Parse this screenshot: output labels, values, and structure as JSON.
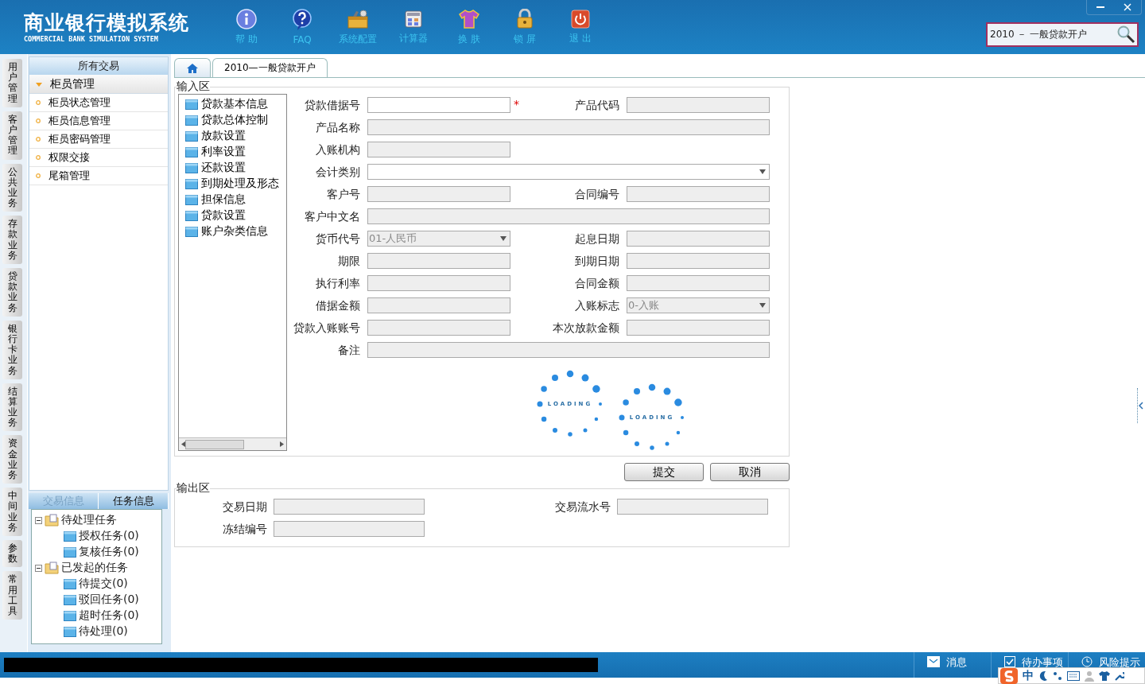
{
  "header": {
    "title": "商业银行模拟系统",
    "subtitle": "COMMERCIAL BANK SIMULATION SYSTEM",
    "tools": [
      {
        "label": "帮 助",
        "kind": "info"
      },
      {
        "label": "FAQ",
        "kind": "question"
      },
      {
        "label": "系统配置",
        "kind": "toolbox"
      },
      {
        "label": "计算器",
        "kind": "calculator"
      },
      {
        "label": "换 肤",
        "kind": "shirt"
      },
      {
        "label": "锁 屏",
        "kind": "lock"
      },
      {
        "label": "退 出",
        "kind": "power"
      }
    ],
    "search": {
      "value": "2010 － 一般贷款开户"
    }
  },
  "side_tabs": [
    {
      "label": "用户管理"
    },
    {
      "label": "客户管理"
    },
    {
      "label": "公共业务"
    },
    {
      "label": "存款业务"
    },
    {
      "label": "贷款业务"
    },
    {
      "label": "银行卡业务"
    },
    {
      "label": "结算业务"
    },
    {
      "label": "资金业务"
    },
    {
      "label": "中间业务"
    },
    {
      "label": "参数"
    },
    {
      "label": "常用工具"
    }
  ],
  "menu": {
    "title": "所有交易",
    "group": {
      "label": "柜员管理",
      "expanded": true,
      "items": [
        "柜员状态管理",
        "柜员信息管理",
        "柜员密码管理",
        "权限交接",
        "尾箱管理"
      ]
    }
  },
  "task_panel": {
    "tabs": [
      {
        "label": "交易信息",
        "selected": false
      },
      {
        "label": "任务信息",
        "selected": true
      }
    ],
    "tree": [
      {
        "label": "待处理任务",
        "expanded": true,
        "children": [
          {
            "label": "授权任务(0)"
          },
          {
            "label": "复核任务(0)"
          }
        ]
      },
      {
        "label": "已发起的任务",
        "expanded": true,
        "children": [
          {
            "label": "待提交(0)"
          },
          {
            "label": "驳回任务(0)"
          },
          {
            "label": "超时任务(0)"
          },
          {
            "label": "待处理(0)"
          }
        ]
      }
    ]
  },
  "tabs": [
    {
      "kind": "home",
      "selected": false
    },
    {
      "kind": "page",
      "label": "2010—一般贷款开户",
      "selected": true
    }
  ],
  "input_area": {
    "title": "输入区",
    "nav_tree": [
      "贷款基本信息",
      "贷款总体控制",
      "放款设置",
      "利率设置",
      "还款设置",
      "到期处理及形态",
      "担保信息",
      "贷款设置",
      "账户杂类信息"
    ],
    "fields": [
      [
        {
          "label": "贷款借据号",
          "kind": "text",
          "disabled": false,
          "required_mark": "*"
        },
        {
          "label": "产品代码",
          "kind": "text",
          "disabled": true
        }
      ],
      [
        {
          "label": "产品名称",
          "kind": "long-text",
          "disabled": true
        }
      ],
      [
        {
          "label": "入账机构",
          "kind": "text",
          "disabled": true
        }
      ],
      [
        {
          "label": "会计类别",
          "kind": "long-select",
          "disabled": false
        }
      ],
      [
        {
          "label": "客户号",
          "kind": "text",
          "disabled": true
        },
        {
          "label": "合同编号",
          "kind": "text",
          "disabled": true
        }
      ],
      [
        {
          "label": "客户中文名",
          "kind": "long-text",
          "disabled": true
        }
      ],
      [
        {
          "label": "货币代号",
          "kind": "select",
          "value": "01-人民币",
          "disabled": true
        },
        {
          "label": "起息日期",
          "kind": "text",
          "disabled": true
        }
      ],
      [
        {
          "label": "期限",
          "kind": "text",
          "disabled": true
        },
        {
          "label": "到期日期",
          "kind": "text",
          "disabled": true
        }
      ],
      [
        {
          "label": "执行利率",
          "kind": "text",
          "disabled": true
        },
        {
          "label": "合同金额",
          "kind": "text",
          "disabled": true
        }
      ],
      [
        {
          "label": "借据金额",
          "kind": "text",
          "disabled": true
        },
        {
          "label": "入账标志",
          "kind": "select",
          "value": "0-入账",
          "disabled": true
        }
      ],
      [
        {
          "label": "贷款入账账号",
          "kind": "text",
          "disabled": true
        },
        {
          "label": "本次放款金额",
          "kind": "text",
          "disabled": true
        }
      ],
      [
        {
          "label": "备注",
          "kind": "long-text",
          "disabled": true
        }
      ]
    ],
    "buttons": [
      "提交",
      "取消"
    ]
  },
  "loading": [
    "LOADING",
    "LOADING"
  ],
  "output_area": {
    "title": "输出区",
    "fields": [
      [
        {
          "label": "交易日期"
        },
        {
          "label": "交易流水号"
        }
      ],
      [
        {
          "label": "冻结编号"
        }
      ]
    ]
  },
  "status_bar": {
    "items": [
      {
        "label": "消息",
        "kind": "mail"
      },
      {
        "label": "待办事项",
        "kind": "check"
      },
      {
        "label": "风险提示",
        "kind": "clock"
      }
    ]
  },
  "ime_bar": {
    "label": "中"
  }
}
